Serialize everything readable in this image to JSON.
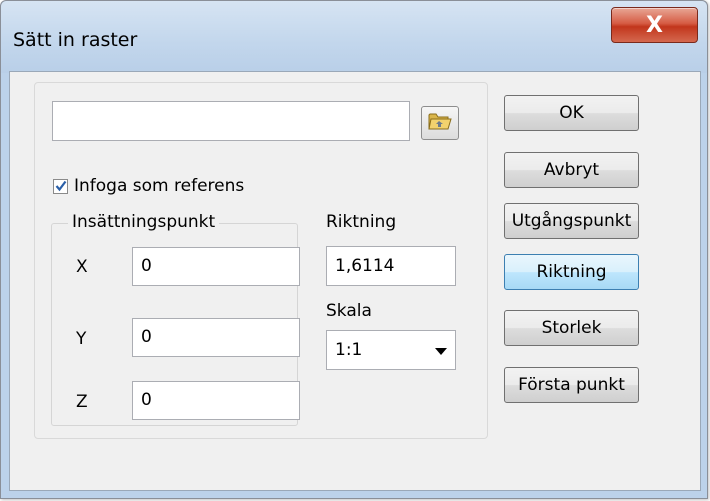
{
  "window": {
    "title": "Sätt in raster",
    "close_label": "X"
  },
  "file": {
    "path_value": "",
    "browse_icon": "folder-icon"
  },
  "reference_checkbox": {
    "label": "Infoga som referens",
    "checked": true
  },
  "insertion_point": {
    "legend": "Insättningspunkt",
    "x_label": "X",
    "x_value": "0",
    "y_label": "Y",
    "y_value": "0",
    "z_label": "Z",
    "z_value": "0"
  },
  "direction": {
    "label": "Riktning",
    "value": "1,6114"
  },
  "scale": {
    "label": "Skala",
    "selected": "1:1"
  },
  "buttons": {
    "ok": "OK",
    "cancel": "Avbryt",
    "origin": "Utgångspunkt",
    "direction": "Riktning",
    "size": "Storlek",
    "first_point": "Första punkt"
  },
  "colors": {
    "close_button": "#c2361c",
    "active_button": "#bee6fd",
    "checkmark": "#2a5fa8"
  }
}
